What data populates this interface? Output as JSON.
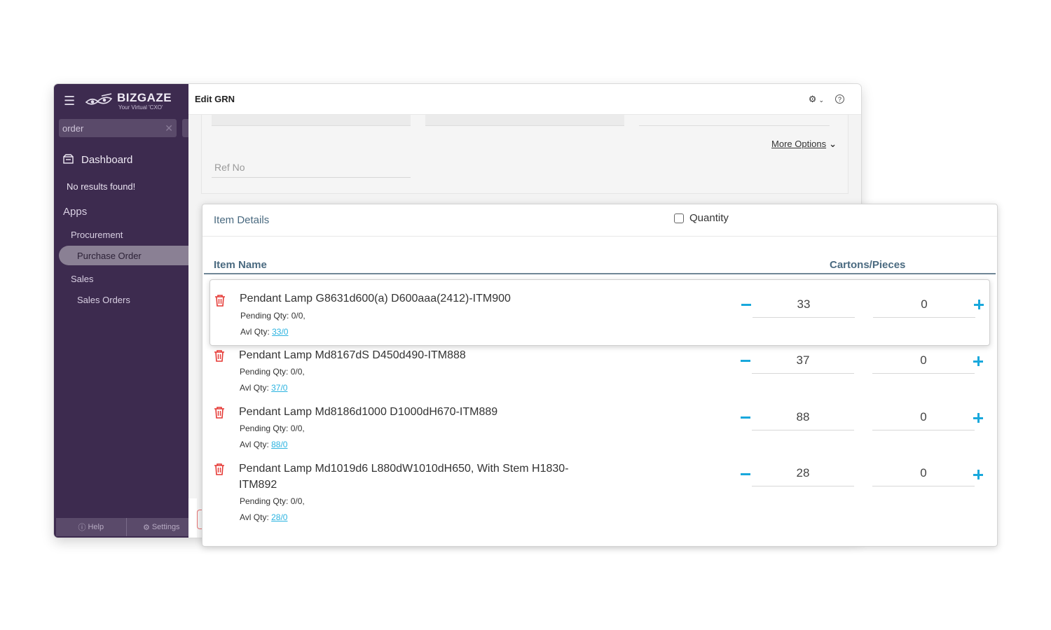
{
  "sidebar": {
    "brand_name": "BIZGAZE",
    "brand_tagline": "Your Virtual 'CXO'",
    "search_value": "order",
    "dashboard_label": "Dashboard",
    "no_results": "No results found!",
    "apps_label": "Apps",
    "procurement_label": "Procurement",
    "purchase_order_label": "Purchase Order",
    "sales_label": "Sales",
    "sales_orders_label": "Sales Orders",
    "help_label": "Help",
    "settings_label": "Settings"
  },
  "main": {
    "title": "Edit GRN",
    "more_options": "More Options",
    "ref_no_placeholder": "Ref No"
  },
  "modal": {
    "title": "Item Details",
    "quantity_label": "Quantity",
    "col_item_name": "Item Name",
    "col_cartons": "Cartons/Pieces",
    "items": [
      {
        "name": "Pendant Lamp G8631d600(a) D600aaa(2412)-ITM900",
        "pending": "Pending Qty: 0/0,",
        "avl_label": "Avl Qty: ",
        "avl_value": "33/0 ",
        "cartons": "33",
        "pieces": "0"
      },
      {
        "name": "Pendant Lamp Md8167dS D450d490-ITM888",
        "pending": "Pending Qty: 0/0,",
        "avl_label": "Avl Qty: ",
        "avl_value": "37/0 ",
        "cartons": "37",
        "pieces": "0"
      },
      {
        "name": "Pendant Lamp Md8186d1000 D1000dH670-ITM889",
        "pending": "Pending Qty: 0/0,",
        "avl_label": "Avl Qty: ",
        "avl_value": "88/0 ",
        "cartons": "88",
        "pieces": "0"
      },
      {
        "name": "Pendant Lamp Md1019d6 L880dW1010dH650, With Stem H1830-ITM892",
        "pending": "Pending Qty: 0/0,",
        "avl_label": "Avl Qty: ",
        "avl_value": "28/0 ",
        "cartons": "28",
        "pieces": "0"
      }
    ]
  },
  "colors": {
    "sidebar_bg": "#3d2b4f",
    "accent_blue": "#19a8dc",
    "link_blue": "#2bb3e0",
    "delete_red": "#e53935",
    "header_text": "#4a6a80"
  }
}
